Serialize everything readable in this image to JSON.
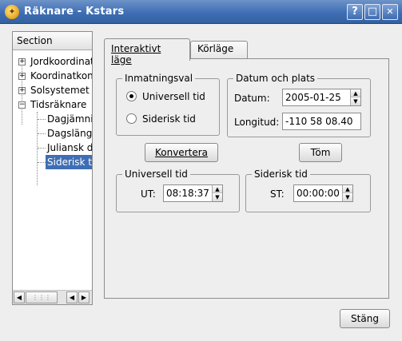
{
  "window": {
    "title": "Räknare - Kstars",
    "help_label": "?",
    "maximize_label": "□",
    "close_label": "✕",
    "app_icon_glyph": "✦"
  },
  "sidebar": {
    "header": "Section",
    "items": [
      {
        "label": "Jordkoordinater",
        "expander": "+"
      },
      {
        "label": "Koordinatkonvertering",
        "expander": "+"
      },
      {
        "label": "Solsystemet",
        "expander": "+"
      },
      {
        "label": "Tidsräknare",
        "expander": "−"
      },
      {
        "label": "Dagjämning"
      },
      {
        "label": "Dagslängd"
      },
      {
        "label": "Juliansk dag"
      },
      {
        "label": "Siderisk tid",
        "selected": true
      }
    ]
  },
  "tabs": [
    {
      "label": "Interaktivt läge",
      "active": true
    },
    {
      "label": "Körläge",
      "active": false
    }
  ],
  "input_group": {
    "title": "Inmatningsval",
    "options": [
      {
        "label": "Universell tid",
        "checked": true
      },
      {
        "label": "Siderisk tid",
        "checked": false
      }
    ]
  },
  "date_group": {
    "title": "Datum och plats",
    "date_label": "Datum:",
    "date_value": "2005-01-25",
    "longitude_label": "Longitud:",
    "longitude_value": "-110 58 08.40"
  },
  "buttons": {
    "convert": "Konvertera",
    "clear": "Töm",
    "close": "Stäng"
  },
  "ut_group": {
    "title": "Universell tid",
    "label": "UT:",
    "value": "08:18:37"
  },
  "st_group": {
    "title": "Siderisk tid",
    "label": "ST:",
    "value": "00:00:00"
  },
  "colors": {
    "titlebar": "#3f6eb5",
    "selection": "#3f6eb5",
    "background": "#eeeeee"
  }
}
